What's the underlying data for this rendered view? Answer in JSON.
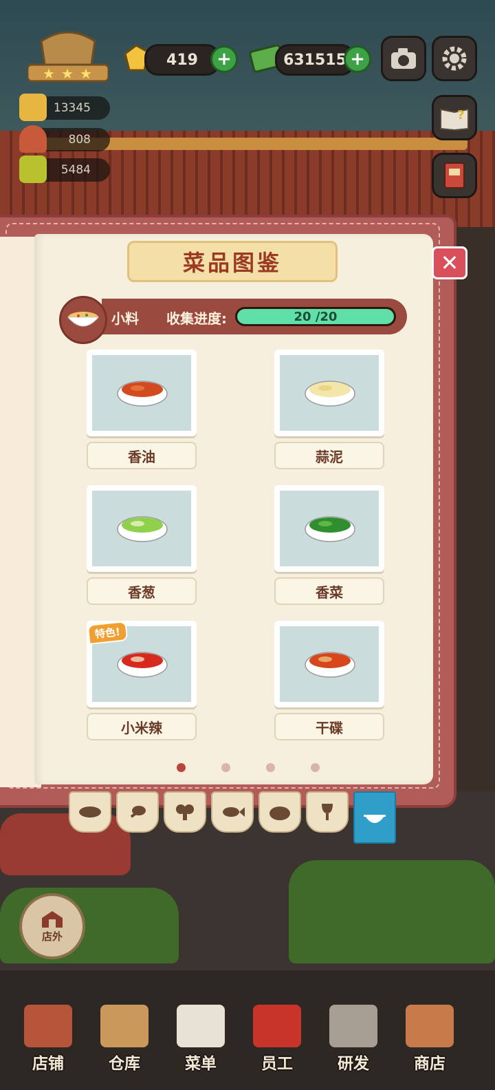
{
  "hud": {
    "gems": "419",
    "cash": "631515",
    "stats": [
      "13345",
      "808",
      "5484"
    ]
  },
  "book": {
    "title": "菜品图鉴",
    "category": "小料",
    "progress_label": "收集进度:",
    "progress_text": "20 /20",
    "progress_fraction": 1.0,
    "special_tag": "特色!",
    "items": [
      {
        "name": "香油",
        "dish": "sesame-oil"
      },
      {
        "name": "蒜泥",
        "dish": "minced-garlic"
      },
      {
        "name": "香葱",
        "dish": "scallion"
      },
      {
        "name": "香菜",
        "dish": "cilantro"
      },
      {
        "name": "小米辣",
        "dish": "chili",
        "special": true
      },
      {
        "name": "干碟",
        "dish": "dry-dip"
      }
    ],
    "page_count": 4,
    "current_page": 1,
    "tabs": [
      "wok-icon",
      "drumstick-icon",
      "broccoli-icon",
      "fish-icon",
      "bread-icon",
      "wine-icon",
      "soup-bowl-icon"
    ],
    "active_tab": 6
  },
  "outside_button": "店外",
  "nav": [
    {
      "label": "店铺"
    },
    {
      "label": "仓库"
    },
    {
      "label": "菜单"
    },
    {
      "label": "员工"
    },
    {
      "label": "研发"
    },
    {
      "label": "商店"
    }
  ],
  "colors": {
    "progress_fill": "#5fe0a8",
    "book_cover": "#b25c5a",
    "active_tab": "#2f9fc9"
  }
}
